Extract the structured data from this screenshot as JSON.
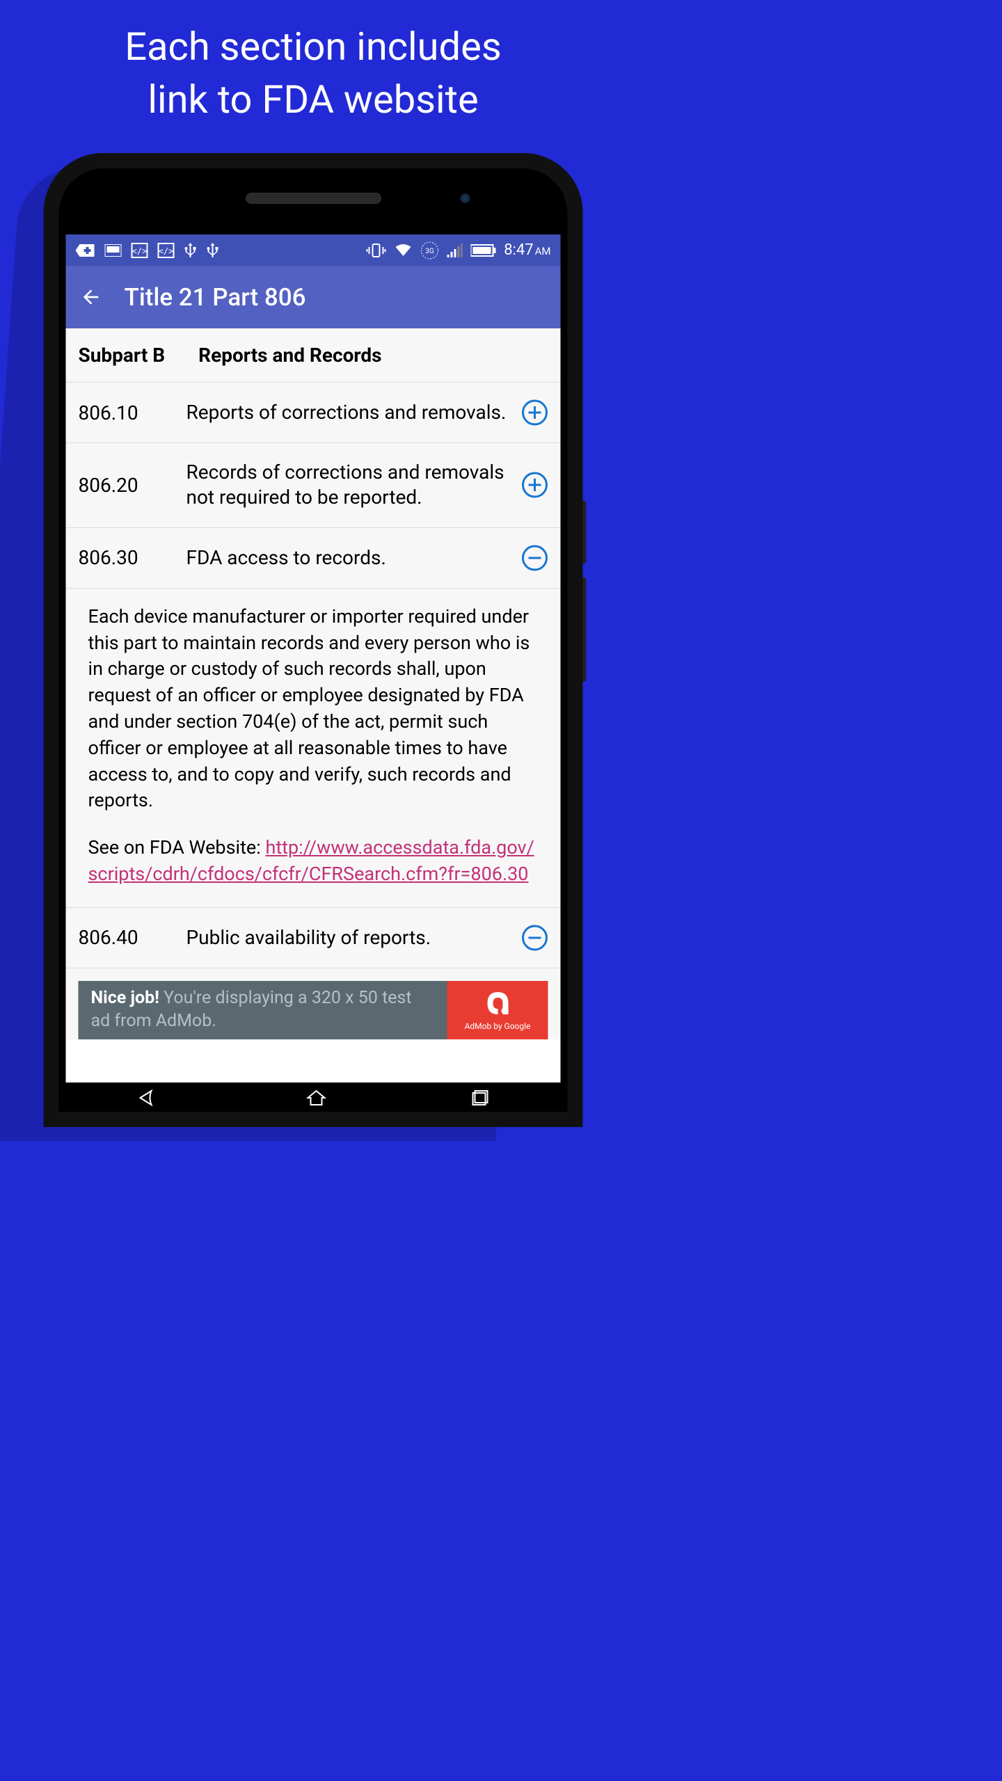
{
  "promo": {
    "line1": "Each section includes",
    "line2": "link to FDA website"
  },
  "status_bar": {
    "time": "8:47",
    "ampm": "AM"
  },
  "app_bar": {
    "title": "Title 21 Part 806"
  },
  "subpart": {
    "label": "Subpart B",
    "title": "Reports and Records"
  },
  "sections": [
    {
      "number": "806.10",
      "title": "Reports of corrections and removals.",
      "expanded": false
    },
    {
      "number": "806.20",
      "title": "Records of corrections and removals not required to be reported.",
      "expanded": false
    },
    {
      "number": "806.30",
      "title": "FDA access to records.",
      "expanded": true,
      "body": "Each device manufacturer or importer required under this part to maintain records and every person who is in charge or custody of such records shall, upon request of an officer or employee designated by FDA and under section 704(e) of the act, permit such officer or employee at all reasonable times to have access to, and to copy and verify, such records and reports.",
      "link_prefix": "See on FDA Website: ",
      "link_url": "http://www.accessdata.fda.gov/scripts/cdrh/cfdocs/cfcfr/CFRSearch.cfm?fr=806.30"
    },
    {
      "number": "806.40",
      "title": "Public availability of reports.",
      "expanded": true
    }
  ],
  "admob": {
    "nice": "Nice job!",
    "text": " You're displaying a 320 x 50 test ad from AdMob.",
    "brand": "AdMob by Google"
  }
}
